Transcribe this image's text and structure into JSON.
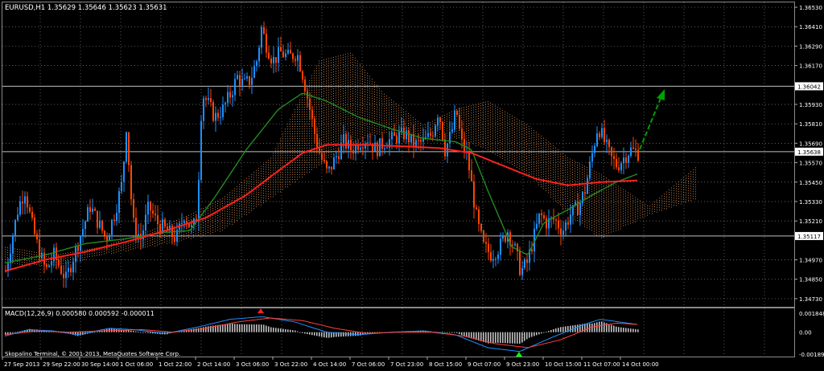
{
  "main_chart": {
    "symbol_header": "EURUSD,H1  1.35629 1.35646 1.35623 1.35631",
    "price_labels": [
      "1.36530",
      "1.36410",
      "1.36290",
      "1.36170",
      "1.35930",
      "1.35810",
      "1.35690",
      "1.35570",
      "1.35450",
      "1.35330",
      "1.35210",
      "1.34970",
      "1.34850",
      "1.34730"
    ],
    "levels": [
      {
        "price": 1.36042,
        "label": "1.36042"
      },
      {
        "price": 1.35638,
        "label": "1.35638"
      },
      {
        "price": 1.35117,
        "label": "1.35117"
      }
    ],
    "colors": {
      "bull": "#1e90ff",
      "bear": "#ff4500",
      "sma_fast": "#228b22",
      "sma_slow": "#ff2020",
      "cloud": "#f4a460",
      "level_line": "#c0c0c0",
      "grid": "#7f7f7f",
      "arrow": "#00a000"
    }
  },
  "macd": {
    "label": "MACD(12,26,9) 0.000580 0.000592 -0.000011",
    "scale_labels": [
      "0.001848",
      "0.00",
      "-0.001891"
    ],
    "colors": {
      "main": "#1e90ff",
      "signal": "#ff4040",
      "hist": "#c0c0c0"
    }
  },
  "copyright": "Skopalino Terminal, © 2001-2013, MetaQuotes Software Corp.",
  "time_labels": [
    "27 Sep 2013",
    "29 Sep 22:00",
    "30 Sep 14:00",
    "1 Oct 06:00",
    "1 Oct 22:00",
    "2 Oct 14:00",
    "3 Oct 06:00",
    "3 Oct 22:00",
    "4 Oct 14:00",
    "7 Oct 06:00",
    "7 Oct 23:00",
    "8 Oct 15:00",
    "9 Oct 07:00",
    "9 Oct 23:00",
    "10 Oct 15:00",
    "11 Oct 07:00",
    "14 Oct 00:00"
  ],
  "chart_data": {
    "type": "candlestick",
    "title": "EURUSD,H1",
    "ylim": [
      1.3468,
      1.3656
    ],
    "price_path": [
      [
        0,
        1.349
      ],
      [
        8,
        1.351
      ],
      [
        16,
        1.353
      ],
      [
        24,
        1.354
      ],
      [
        32,
        1.352
      ],
      [
        40,
        1.3505
      ],
      [
        50,
        1.349
      ],
      [
        60,
        1.35
      ],
      [
        75,
        1.3485
      ],
      [
        85,
        1.35
      ],
      [
        95,
        1.3515
      ],
      [
        105,
        1.353
      ],
      [
        115,
        1.352
      ],
      [
        125,
        1.351
      ],
      [
        135,
        1.3525
      ],
      [
        145,
        1.3545
      ],
      [
        150,
        1.358
      ],
      [
        158,
        1.352
      ],
      [
        168,
        1.351
      ],
      [
        178,
        1.353
      ],
      [
        188,
        1.352
      ],
      [
        200,
        1.3515
      ],
      [
        212,
        1.351
      ],
      [
        222,
        1.3525
      ],
      [
        232,
        1.3515
      ],
      [
        238,
        1.3525
      ],
      [
        244,
        1.36
      ],
      [
        250,
        1.3595
      ],
      [
        260,
        1.3585
      ],
      [
        270,
        1.359
      ],
      [
        280,
        1.36
      ],
      [
        288,
        1.361
      ],
      [
        296,
        1.3605
      ],
      [
        304,
        1.3608
      ],
      [
        312,
        1.362
      ],
      [
        318,
        1.364
      ],
      [
        324,
        1.363
      ],
      [
        332,
        1.362
      ],
      [
        342,
        1.3625
      ],
      [
        352,
        1.3622
      ],
      [
        362,
        1.3625
      ],
      [
        370,
        1.361
      ],
      [
        378,
        1.359
      ],
      [
        386,
        1.357
      ],
      [
        392,
        1.356
      ],
      [
        400,
        1.355
      ],
      [
        410,
        1.356
      ],
      [
        420,
        1.357
      ],
      [
        430,
        1.3565
      ],
      [
        440,
        1.357
      ],
      [
        450,
        1.3572
      ],
      [
        460,
        1.3565
      ],
      [
        472,
        1.357
      ],
      [
        484,
        1.3572
      ],
      [
        496,
        1.3575
      ],
      [
        508,
        1.3568
      ],
      [
        520,
        1.357
      ],
      [
        530,
        1.3575
      ],
      [
        538,
        1.359
      ],
      [
        546,
        1.3565
      ],
      [
        554,
        1.3575
      ],
      [
        560,
        1.359
      ],
      [
        566,
        1.357
      ],
      [
        574,
        1.356
      ],
      [
        580,
        1.354
      ],
      [
        586,
        1.352
      ],
      [
        594,
        1.3505
      ],
      [
        604,
        1.35
      ],
      [
        614,
        1.3505
      ],
      [
        624,
        1.3515
      ],
      [
        632,
        1.3505
      ],
      [
        640,
        1.349
      ],
      [
        648,
        1.3495
      ],
      [
        656,
        1.351
      ],
      [
        664,
        1.3525
      ],
      [
        672,
        1.352
      ],
      [
        682,
        1.3522
      ],
      [
        692,
        1.3515
      ],
      [
        702,
        1.3525
      ],
      [
        712,
        1.353
      ],
      [
        720,
        1.354
      ],
      [
        728,
        1.356
      ],
      [
        736,
        1.358
      ],
      [
        744,
        1.357
      ],
      [
        752,
        1.356
      ],
      [
        760,
        1.3555
      ],
      [
        768,
        1.356
      ],
      [
        776,
        1.3565
      ],
      [
        786,
        1.3563
      ]
    ],
    "sma_slow_path": [
      [
        0,
        1.349
      ],
      [
        50,
        1.3497
      ],
      [
        100,
        1.3502
      ],
      [
        150,
        1.3508
      ],
      [
        200,
        1.3515
      ],
      [
        250,
        1.3523
      ],
      [
        300,
        1.3537
      ],
      [
        340,
        1.3552
      ],
      [
        370,
        1.3563
      ],
      [
        400,
        1.3568
      ],
      [
        450,
        1.3568
      ],
      [
        500,
        1.3567
      ],
      [
        540,
        1.3566
      ],
      [
        580,
        1.3563
      ],
      [
        620,
        1.3555
      ],
      [
        660,
        1.3547
      ],
      [
        700,
        1.3543
      ],
      [
        740,
        1.3545
      ],
      [
        786,
        1.3546
      ]
    ],
    "sma_fast_path": [
      [
        0,
        1.3495
      ],
      [
        50,
        1.35
      ],
      [
        100,
        1.3507
      ],
      [
        150,
        1.351
      ],
      [
        200,
        1.3514
      ],
      [
        230,
        1.3515
      ],
      [
        260,
        1.3535
      ],
      [
        300,
        1.3565
      ],
      [
        340,
        1.359
      ],
      [
        370,
        1.36
      ],
      [
        400,
        1.3595
      ],
      [
        440,
        1.3585
      ],
      [
        480,
        1.3578
      ],
      [
        520,
        1.3572
      ],
      [
        560,
        1.357
      ],
      [
        580,
        1.3565
      ],
      [
        600,
        1.354
      ],
      [
        630,
        1.3505
      ],
      [
        650,
        1.35
      ],
      [
        670,
        1.352
      ],
      [
        700,
        1.3528
      ],
      [
        730,
        1.3537
      ],
      [
        760,
        1.3545
      ],
      [
        786,
        1.355
      ]
    ]
  }
}
